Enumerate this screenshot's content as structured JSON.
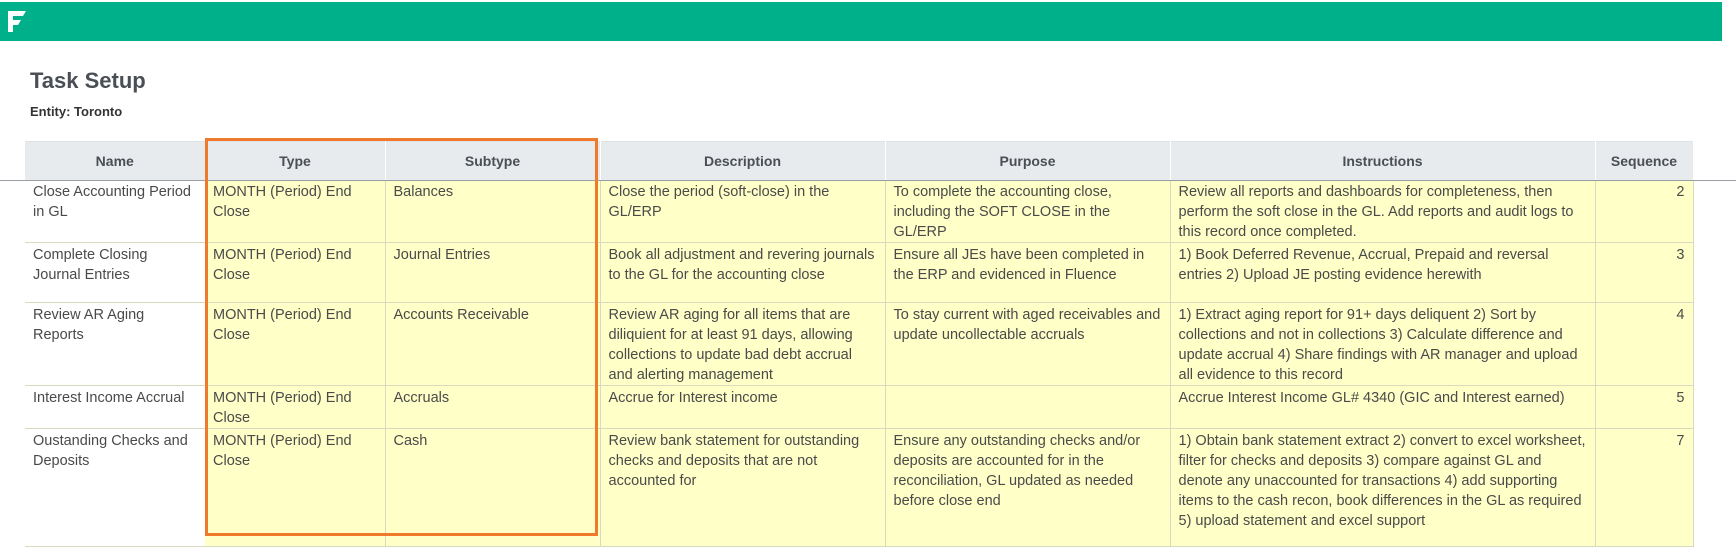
{
  "colors": {
    "brand": "#00b08b",
    "highlight": "#f07a2c",
    "row_bg": "#ffffc8",
    "header_bg": "#e8ebee"
  },
  "topbar": {
    "logo_icon": "fluence-logo-icon"
  },
  "page": {
    "title": "Task Setup",
    "entity_label": "Entity: Toronto"
  },
  "table": {
    "headers": [
      "Name",
      "Type",
      "Subtype",
      "Description",
      "Purpose",
      "Instructions",
      "Sequence"
    ],
    "rows": [
      {
        "name": "Close Accounting Period in GL",
        "type": "MONTH (Period) End Close",
        "subtype": "Balances",
        "description": "Close the period (soft-close) in the GL/ERP",
        "purpose": "To complete the accounting close, including the SOFT CLOSE in the GL/ERP",
        "instructions": "Review all reports and dashboards for completeness, then perform the soft close in the GL.  Add reports and audit logs to this record once completed.",
        "sequence": "2"
      },
      {
        "name": "Complete Closing Journal Entries",
        "type": "MONTH (Period) End Close",
        "subtype": "Journal Entries",
        "description": "Book all adjustment and revering journals to the GL for the accounting close",
        "purpose": "Ensure all JEs have been completed in the ERP and evidenced in Fluence",
        "instructions": "1) Book Deferred Revenue, Accrual, Prepaid and reversal entries  2) Upload JE posting evidence herewith",
        "sequence": "3"
      },
      {
        "name": "Review AR Aging Reports",
        "type": "MONTH (Period) End Close",
        "subtype": "Accounts Receivable",
        "description": "Review AR aging for all items that are diliquient for at least 91 days, allowing collections to update bad debt accrual and alerting management",
        "purpose": "To stay current with aged receivables and update uncollectable accruals",
        "instructions": "1) Extract aging report for 91+ days deliquent  2) Sort by collections and not in collections  3) Calculate difference and update accrual  4) Share findings with AR manager and upload all evidence to this record",
        "sequence": "4"
      },
      {
        "name": "Interest Income Accrual",
        "type": "MONTH (Period) End Close",
        "subtype": "Accruals",
        "description": "Accrue for Interest income",
        "purpose": "",
        "instructions": "Accrue Interest Income GL# 4340 (GIC and Interest earned)",
        "sequence": "5"
      },
      {
        "name": "Oustanding Checks and Deposits",
        "type": "MONTH (Period) End Close",
        "subtype": "Cash",
        "description": "Review bank statement for outstanding checks and deposits that are not accounted for",
        "purpose": "Ensure any outstanding checks and/or deposits are accounted for in the reconciliation, GL updated as needed before close end",
        "instructions": "1) Obtain bank statement extract  2) convert to excel worksheet, filter for checks and deposits  3) compare against GL and denote any unaccounted for transactions 4) add supporting items to the cash recon, book differences in the GL as required 5) upload statement and excel support",
        "sequence": "7"
      }
    ]
  }
}
